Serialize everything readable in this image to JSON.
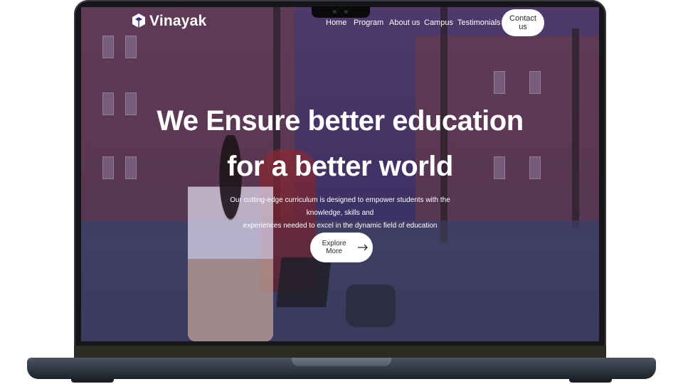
{
  "brand": {
    "name": "Vinayak",
    "icon": "graduation-cap-icon"
  },
  "nav": {
    "items": [
      {
        "label": "Home"
      },
      {
        "label": "Program"
      },
      {
        "label": "About us"
      },
      {
        "label": "Campus"
      },
      {
        "label": "Testimonials"
      }
    ],
    "contact_label": "Contact us"
  },
  "hero": {
    "title_line1": "We Ensure better education",
    "title_line2": "for a better world",
    "subtitle_line1": "Our cutting-edge curriculum is designed to empower students with the knowledge, skills and",
    "subtitle_line2": "experiences needed to excel in the dynamic field of education",
    "cta_label": "Explore More",
    "cta_icon": "arrow-right-icon"
  },
  "colors": {
    "overlay": "#3b3280",
    "cta_bg": "#ffffff",
    "text_on_hero": "#ffffff"
  }
}
